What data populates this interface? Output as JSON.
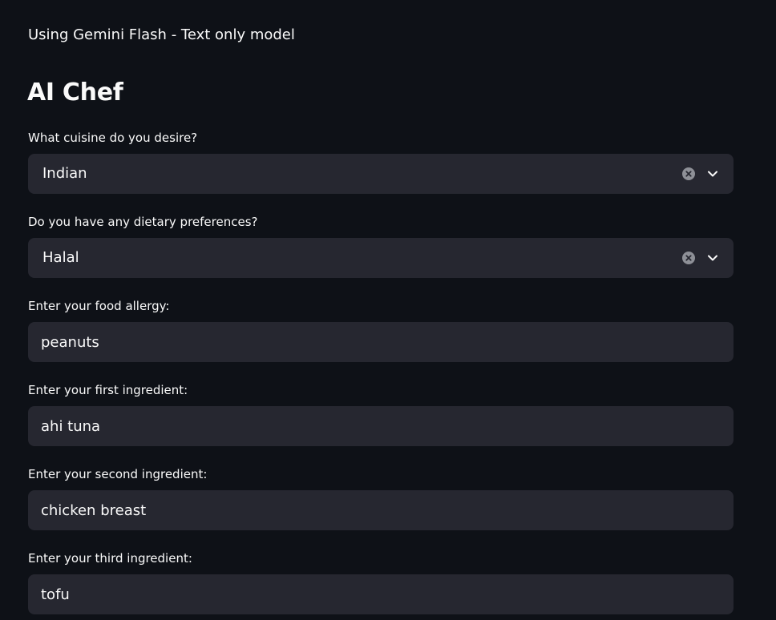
{
  "caption": "Using Gemini Flash - Text only model",
  "title": "AI Chef",
  "cuisine": {
    "label": "What cuisine do you desire?",
    "value": "Indian"
  },
  "dietary": {
    "label": "Do you have any dietary preferences?",
    "value": "Halal"
  },
  "allergy": {
    "label": "Enter your food allergy:",
    "value": "peanuts"
  },
  "ingredient1": {
    "label": "Enter your first ingredient:",
    "value": "ahi tuna"
  },
  "ingredient2": {
    "label": "Enter your second ingredient:",
    "value": "chicken breast"
  },
  "ingredient3": {
    "label": "Enter your third ingredient:",
    "value": "tofu"
  },
  "icons": {
    "clear": "clear-circle-icon",
    "expand": "chevron-down-icon"
  },
  "colors": {
    "background": "#0e1117",
    "input_background": "#262730",
    "text": "#fafafa",
    "icon": "#8e9097"
  }
}
